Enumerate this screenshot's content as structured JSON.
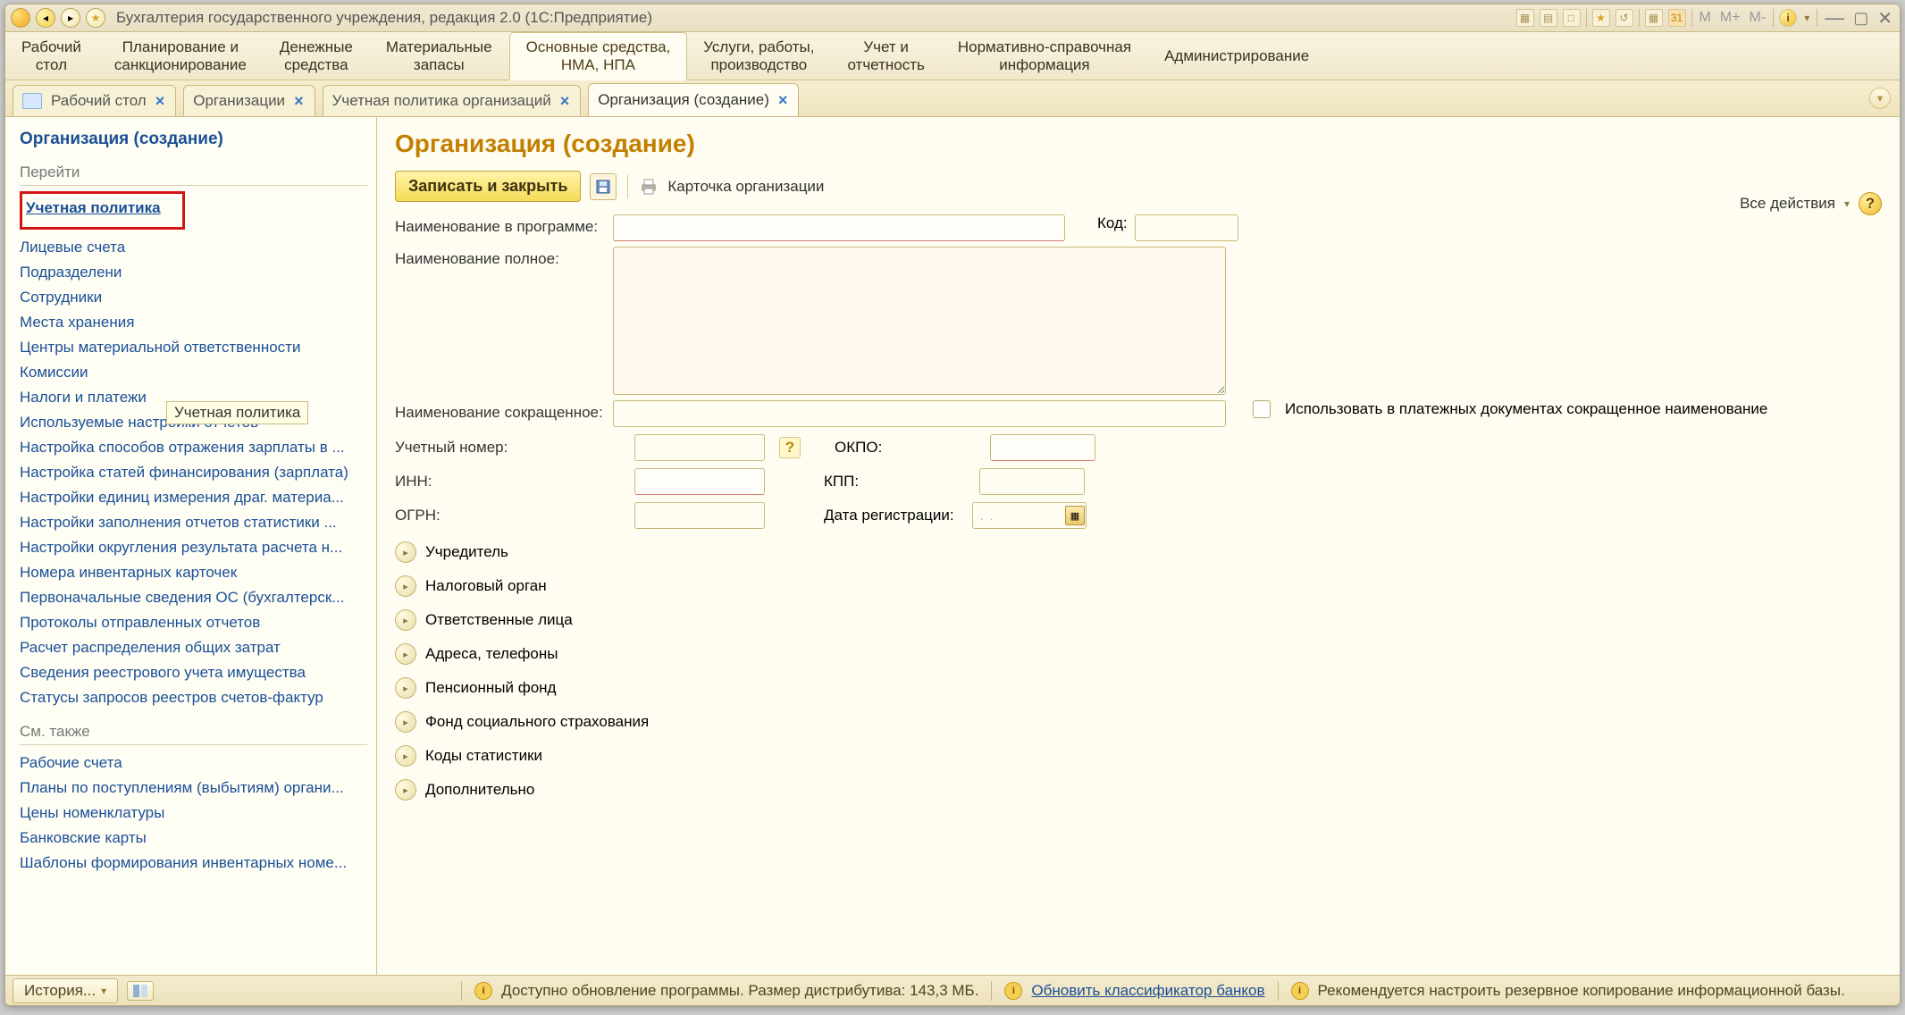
{
  "titlebar": {
    "app_title": "Бухгалтерия государственного учреждения, редакция 2.0  (1С:Предприятие)",
    "mem_buttons": [
      "M",
      "M+",
      "M-"
    ]
  },
  "sections": [
    {
      "l1": "Рабочий",
      "l2": "стол"
    },
    {
      "l1": "Планирование и",
      "l2": "санкционирование"
    },
    {
      "l1": "Денежные",
      "l2": "средства"
    },
    {
      "l1": "Материальные",
      "l2": "запасы"
    },
    {
      "l1": "Основные средства,",
      "l2": "НМА, НПА"
    },
    {
      "l1": "Услуги, работы,",
      "l2": "производство"
    },
    {
      "l1": "Учет и",
      "l2": "отчетность"
    },
    {
      "l1": "Нормативно-справочная",
      "l2": "информация"
    },
    {
      "l1": "Администрирование",
      "l2": ""
    }
  ],
  "active_section_index": 4,
  "tabs": [
    {
      "label": "Рабочий стол",
      "has_icon": true
    },
    {
      "label": "Организации"
    },
    {
      "label": "Учетная политика организаций"
    },
    {
      "label": "Организация (создание)",
      "active": true
    }
  ],
  "nav": {
    "title": "Организация (создание)",
    "section_go": "Перейти",
    "emph": "Учетная политика",
    "tooltip": "Учетная политика",
    "links": [
      "Лицевые счета",
      "Подразделени",
      "Сотрудники",
      "Места хранения",
      "Центры материальной ответственности",
      "Комиссии",
      "Налоги и платежи",
      "Используемые настройки отчетов",
      "Настройка способов отражения зарплаты в ...",
      "Настройка статей финансирования (зарплата)",
      "Настройки единиц измерения драг. материа...",
      "Настройки заполнения отчетов статистики ...",
      "Настройки округления результата расчета н...",
      "Номера инвентарных карточек",
      "Первоначальные сведения ОС (бухгалтерск...",
      "Протоколы отправленных отчетов",
      "Расчет распределения общих затрат",
      "Сведения реестрового учета имущества",
      "Статусы запросов реестров счетов-фактур"
    ],
    "section_see": "См. также",
    "see_links": [
      "Рабочие счета",
      "Планы по поступлениям (выбытиям) органи...",
      "Цены номенклатуры",
      "Банковские карты",
      "Шаблоны формирования инвентарных номе..."
    ]
  },
  "content": {
    "title": "Организация (создание)",
    "btn_save": "Записать и закрыть",
    "org_card": "Карточка организации",
    "all_actions": "Все действия",
    "labels": {
      "name_prog": "Наименование в программе:",
      "code": "Код:",
      "name_full": "Наименование полное:",
      "name_short": "Наименование сокращенное:",
      "use_short": "Использовать в платежных документах сокращенное наименование",
      "account_no": "Учетный номер:",
      "okpo": "ОКПО:",
      "inn": "ИНН:",
      "kpp": "КПП:",
      "ogrn": "ОГРН:",
      "reg_date": "Дата регистрации:",
      "date_placeholder": " .  ."
    },
    "expanders": [
      "Учредитель",
      "Налоговый орган",
      "Ответственные лица",
      "Адреса, телефоны",
      "Пенсионный фонд",
      "Фонд социального страхования",
      "Коды статистики",
      "Дополнительно"
    ]
  },
  "statusbar": {
    "history": "История...",
    "update_text": "Доступно обновление программы. Размер дистрибутива: 143,3 МБ.",
    "bank": "Обновить классификатор банков",
    "backup": "Рекомендуется настроить резервное копирование информационной базы."
  }
}
